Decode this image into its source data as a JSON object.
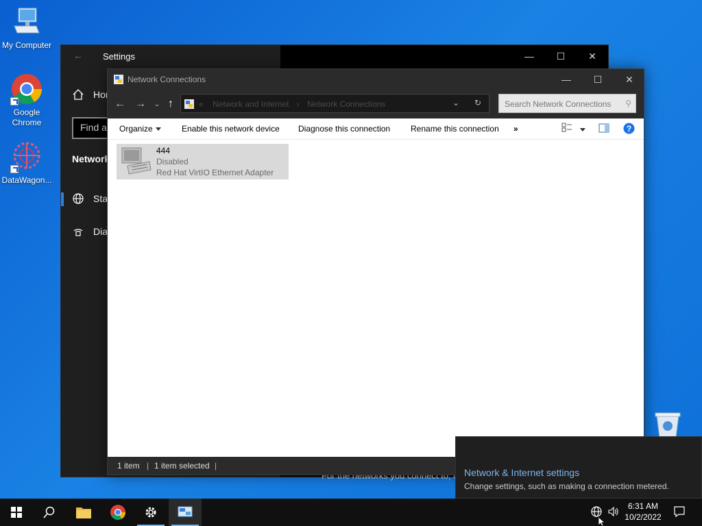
{
  "desktop": {
    "icons": [
      {
        "label": "My Computer"
      },
      {
        "label": "Google Chrome"
      },
      {
        "label": "DataWagon..."
      }
    ]
  },
  "settings": {
    "title": "Settings",
    "nav_home": "Home",
    "search_placeholder": "Find a setting",
    "section": "Network & Internet",
    "nav_status": "Status",
    "nav_dialup": "Dial-up",
    "footer_text": "For the networks you connect to, c"
  },
  "network_connections": {
    "title": "Network Connections",
    "breadcrumb": [
      "Network and Internet",
      "Network Connections"
    ],
    "search_placeholder": "Search Network Connections",
    "commands": {
      "organize": "Organize",
      "enable": "Enable this network device",
      "diagnose": "Diagnose this connection",
      "rename": "Rename this connection",
      "more": "»"
    },
    "adapter": {
      "name": "444",
      "status": "Disabled",
      "description": "Red Hat VirtIO Ethernet Adapter"
    },
    "statusbar": {
      "count": "1 item",
      "selected": "1 item selected"
    }
  },
  "notification": {
    "title": "Network & Internet settings",
    "body": "Change settings, such as making a connection metered."
  },
  "taskbar": {
    "time": "6:31 AM",
    "date": "10/2/2022"
  },
  "colors": {
    "accent": "#2f7fd8",
    "desktop": "#1a82e4",
    "link": "#7fb8f0"
  }
}
